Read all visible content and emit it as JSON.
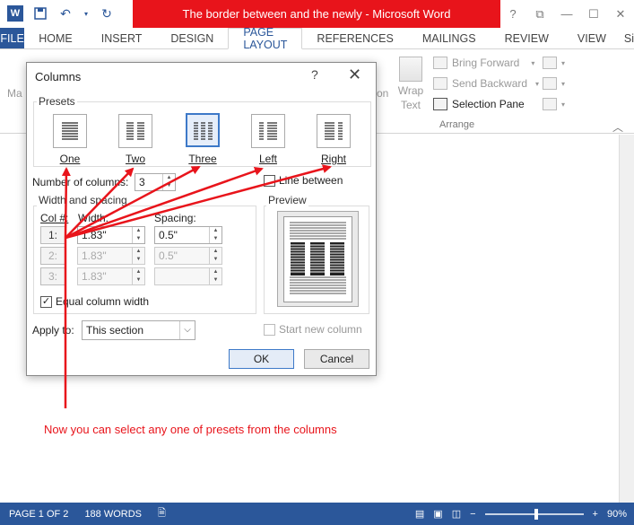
{
  "window": {
    "title": "The border between and the newly -  Microsoft Word",
    "controls": [
      "?",
      "⧉",
      "—",
      "☐",
      "✕"
    ]
  },
  "ribbon": {
    "tabs": [
      "FILE",
      "HOME",
      "INSERT",
      "DESIGN",
      "PAGE LAYOUT",
      "REFERENCES",
      "MAILINGS",
      "REVIEW",
      "VIEW",
      "Si"
    ],
    "active_tab": "PAGE LAYOUT",
    "arrange": {
      "bring_forward": "Bring Forward",
      "send_backward": "Send Backward",
      "selection_pane": "Selection Pane",
      "wrap_text_1": "Wrap",
      "wrap_text_2": "Text",
      "partial_left_1": "Ma",
      "partial_on": "on",
      "group_label": "Arrange"
    }
  },
  "dialog": {
    "title": "Columns",
    "help": "?",
    "close": "✕",
    "presets_label": "Presets",
    "presets": [
      {
        "label": "One"
      },
      {
        "label": "Two"
      },
      {
        "label": "Three"
      },
      {
        "label": "Left"
      },
      {
        "label": "Right"
      }
    ],
    "selected_preset": "Three",
    "number_of_columns_label": "Number of columns:",
    "number_of_columns": "3",
    "line_between_label": "Line between",
    "width_spacing_label": "Width and spacing",
    "col_header": "Col #:",
    "width_header": "Width:",
    "spacing_header": "Spacing:",
    "rows": [
      {
        "col": "1:",
        "width": "1.83\"",
        "spacing": "0.5\""
      },
      {
        "col": "2:",
        "width": "1.83\"",
        "spacing": "0.5\""
      },
      {
        "col": "3:",
        "width": "1.83\"",
        "spacing": ""
      }
    ],
    "equal_width_label": "Equal column width",
    "equal_width_checked": true,
    "preview_label": "Preview",
    "apply_to_label": "Apply to:",
    "apply_to_value": "This section",
    "start_new_column_label": "Start new column",
    "ok": "OK",
    "cancel": "Cancel"
  },
  "annotation": "Now you can select any one of presets from the columns",
  "status": {
    "page": "PAGE 1 OF 2",
    "words": "188 WORDS",
    "zoom": "90%"
  },
  "colors": {
    "accent": "#2b579a",
    "title_red": "#e8141b",
    "arrow": "#e8141b"
  }
}
